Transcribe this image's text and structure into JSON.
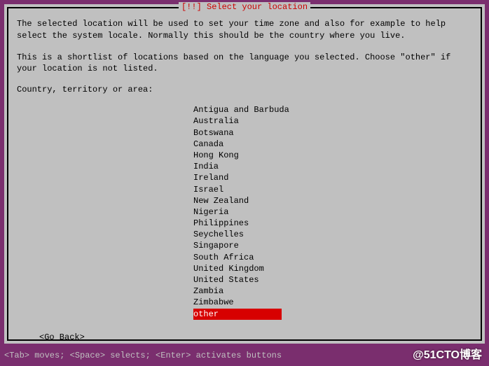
{
  "dialog": {
    "title": "[!!] Select your location",
    "help_para1": "The selected location will be used to set your time zone and also for example to help select the system locale. Normally this should be the country where you live.",
    "help_para2": "This is a shortlist of locations based on the language you selected. Choose \"other\" if your location is not listed.",
    "prompt": "Country, territory or area:",
    "locations": [
      "Antigua and Barbuda",
      "Australia",
      "Botswana",
      "Canada",
      "Hong Kong",
      "India",
      "Ireland",
      "Israel",
      "New Zealand",
      "Nigeria",
      "Philippines",
      "Seychelles",
      "Singapore",
      "South Africa",
      "United Kingdom",
      "United States",
      "Zambia",
      "Zimbabwe",
      "other"
    ],
    "selected_index": 18,
    "go_back": "<Go Back>"
  },
  "footer": {
    "hint": "<Tab> moves; <Space> selects; <Enter> activates buttons"
  },
  "watermark": "@51CTO博客"
}
